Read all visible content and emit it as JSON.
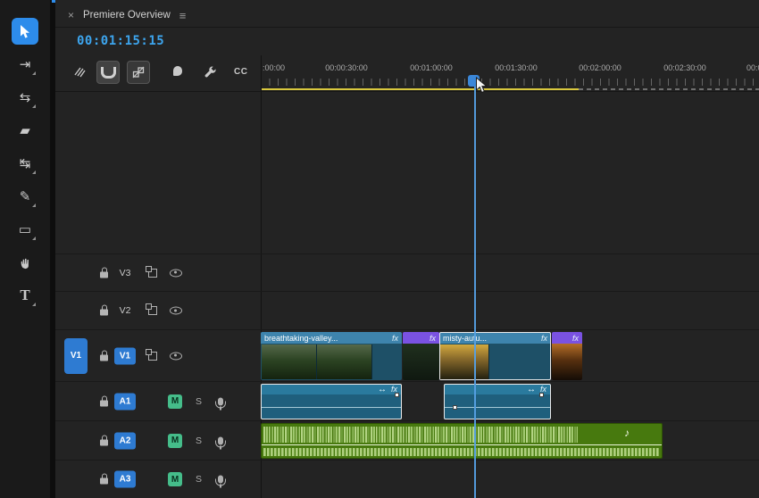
{
  "panel": {
    "close_label": "×",
    "title": "Premiere Overview",
    "menu_label": "≡"
  },
  "timecode": "00:01:15:15",
  "toolbar": {
    "cc_label": "CC"
  },
  "ruler": {
    "labels": [
      ":00:00",
      "00:00:30:00",
      "00:01:00:00",
      "00:01:30:00",
      "00:02:00:00",
      "00:02:30:00",
      "00:0"
    ]
  },
  "tools": {
    "track_select_glyph": "⇥",
    "ripple_glyph": "⇆",
    "razor_glyph": "▰",
    "slip_glyph": "↹",
    "pen_glyph": "✎",
    "rect_glyph": "▭",
    "type_glyph": "T"
  },
  "icons": {
    "selection": "selection-tool-cursor",
    "snap": "magnet-icon",
    "linked_selection": "linked-selection-icon",
    "marker": "marker-flag-icon",
    "settings": "wrench-icon",
    "lock": "lock-icon",
    "sync_lock": "sync-lock-icon",
    "output": "eye-icon",
    "voiceover": "microphone-icon"
  },
  "tracks": {
    "video": [
      {
        "label": "V3"
      },
      {
        "label": "V2"
      },
      {
        "label": "V1",
        "source_badge": "V1",
        "target_badge": "V1"
      }
    ],
    "audio": [
      {
        "badge": "A1",
        "mute": "M",
        "solo": "S"
      },
      {
        "badge": "A2",
        "mute": "M",
        "solo": "S"
      },
      {
        "badge": "A3",
        "mute": "M",
        "solo": "S"
      }
    ]
  },
  "clips": {
    "v1": [
      {
        "name": "breathtaking-valley...",
        "fx": "fx"
      },
      {
        "fx": "fx"
      },
      {
        "name": "misty-autu...",
        "fx": "fx"
      },
      {
        "fx": "fx"
      }
    ],
    "a1": [
      {
        "stretch": "↔",
        "fx": "fx"
      },
      {
        "stretch": "↔",
        "fx": "fx"
      }
    ],
    "a2": {
      "note": "♪"
    }
  },
  "colors": {
    "accent": "#2d8ceb",
    "timecode_blue": "#3da5ee",
    "clip_blue": "#2f7da8",
    "clip_purple": "#7a52e2",
    "clip_green": "#47790e",
    "mute_green": "#45bd8a",
    "workarea_yellow": "#d9c83e"
  }
}
